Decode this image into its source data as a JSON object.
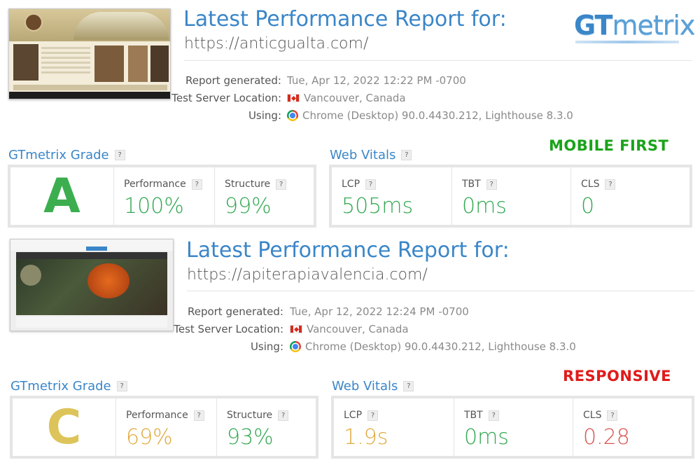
{
  "logo": {
    "gt": "GT",
    "metrix": "metrix"
  },
  "reports": [
    {
      "title": "Latest Performance Report for:",
      "url": "https://anticgualta.com/",
      "meta": {
        "generated_label": "Report generated:",
        "generated_value": "Tue, Apr 12, 2022 12:22 PM -0700",
        "location_label": "Test Server Location:",
        "location_value": "Vancouver, Canada",
        "using_label": "Using:",
        "using_value": "Chrome (Desktop) 90.0.4430.212, Lighthouse 8.3.0"
      },
      "grade_heading": "GTmetrix Grade",
      "vitals_heading": "Web Vitals",
      "grade": "A",
      "performance_label": "Performance",
      "performance": "100%",
      "structure_label": "Structure",
      "structure": "99%",
      "lcp_label": "LCP",
      "lcp": "505ms",
      "tbt_label": "TBT",
      "tbt": "0ms",
      "cls_label": "CLS",
      "cls": "0",
      "banner": "MOBILE FIRST",
      "banner_color": "#1aa31a"
    },
    {
      "title": "Latest Performance Report for:",
      "url": "https://apiterapiavalencia.com/",
      "meta": {
        "generated_label": "Report generated:",
        "generated_value": "Tue, Apr 12, 2022 12:24 PM -0700",
        "location_label": "Test Server Location:",
        "location_value": "Vancouver, Canada",
        "using_label": "Using:",
        "using_value": "Chrome (Desktop) 90.0.4430.212, Lighthouse 8.3.0"
      },
      "grade_heading": "GTmetrix Grade",
      "vitals_heading": "Web Vitals",
      "grade": "C",
      "performance_label": "Performance",
      "performance": "69%",
      "structure_label": "Structure",
      "structure": "93%",
      "lcp_label": "LCP",
      "lcp": "1.9s",
      "tbt_label": "TBT",
      "tbt": "0ms",
      "cls_label": "CLS",
      "cls": "0.28",
      "banner": "RESPONSIVE",
      "banner_color": "#e01b1b"
    }
  ],
  "help_glyph": "?",
  "colors": {
    "accent": "#3a86c8",
    "good": "#34a853",
    "warn": "#e0a93b",
    "bad": "#d9534f"
  }
}
